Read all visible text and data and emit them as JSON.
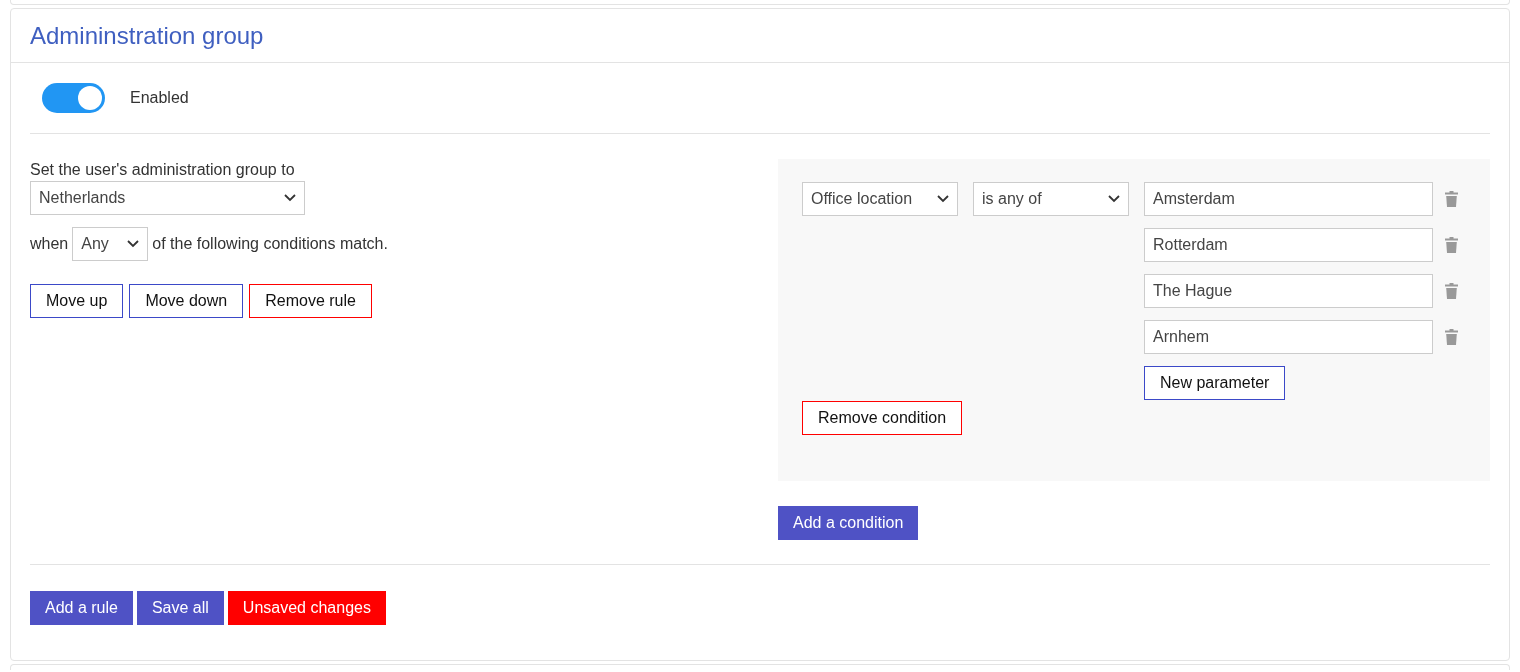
{
  "card": {
    "title": "Admininstration group"
  },
  "toggle": {
    "label": "Enabled",
    "on": true
  },
  "rule": {
    "prefix": "Set the user's administration group to",
    "group_select": "Netherlands",
    "when_label": "when",
    "match_select": "Any",
    "suffix": "of the following conditions match.",
    "buttons": [
      {
        "label": "Move up",
        "kind": "default"
      },
      {
        "label": "Move down",
        "kind": "default"
      },
      {
        "label": "Remove rule",
        "kind": "danger"
      }
    ]
  },
  "conditions": [
    {
      "field": "Office location",
      "operator": "is any of",
      "parameters": [
        "Amsterdam",
        "Rotterdam",
        "The Hague",
        "Arnhem"
      ],
      "new_parameter": "New parameter",
      "remove": "Remove condition"
    }
  ],
  "add_condition": "Add a condition",
  "footer_buttons": [
    {
      "label": "Add a rule",
      "kind": "primary"
    },
    {
      "label": "Save all",
      "kind": "primary"
    },
    {
      "label": "Unsaved changes",
      "kind": "alert"
    }
  ]
}
